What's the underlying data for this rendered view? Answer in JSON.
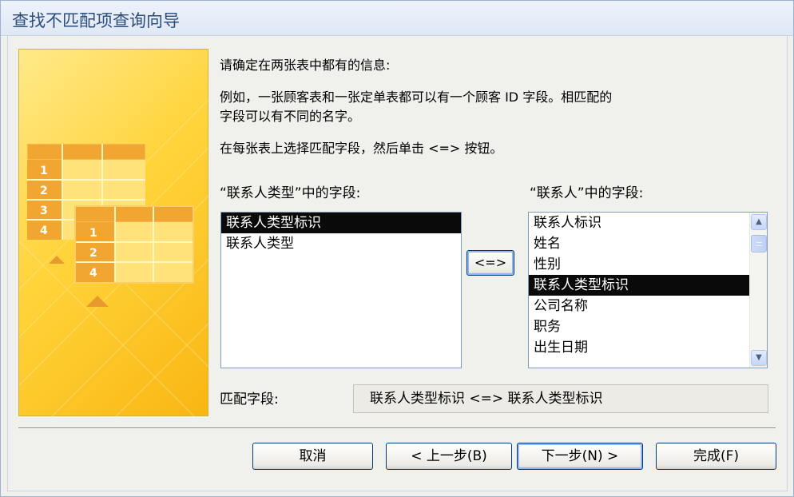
{
  "window": {
    "title": "查找不匹配项查询向导"
  },
  "instructions": {
    "line1": "请确定在两张表中都有的信息:",
    "line2": "例如，一张顾客表和一张定单表都可以有一个顾客 ID 字段。相匹配的",
    "line3": "字段可以有不同的名字。",
    "line4": "在每张表上选择匹配字段，然后单击 <=> 按钮。"
  },
  "left_list": {
    "label": "“联系人类型”中的字段:",
    "items": [
      "联系人类型标识",
      "联系人类型"
    ],
    "selected": "联系人类型标识"
  },
  "right_list": {
    "label": "“联系人”中的字段:",
    "items": [
      "联系人标识",
      "姓名",
      "性别",
      "联系人类型标识",
      "公司名称",
      "职务",
      "出生日期"
    ],
    "selected": "联系人类型标识"
  },
  "match_button": {
    "label": "<=>"
  },
  "matched": {
    "label": "匹配字段:",
    "value": "联系人类型标识 <=> 联系人类型标识"
  },
  "buttons": {
    "cancel": "取消",
    "back": "< 上一步(B)",
    "next": "下一步(N) >",
    "finish": "完成(F)"
  },
  "artwork": {
    "numbers_back": [
      "1",
      "2",
      "3",
      "4"
    ],
    "numbers_front": [
      "1",
      "2",
      "4"
    ]
  },
  "colors": {
    "title_text": "#2d4c7a",
    "selection": "#0a0a0a",
    "art_yellow": "#ffd43a",
    "art_orange": "#f0a020"
  }
}
